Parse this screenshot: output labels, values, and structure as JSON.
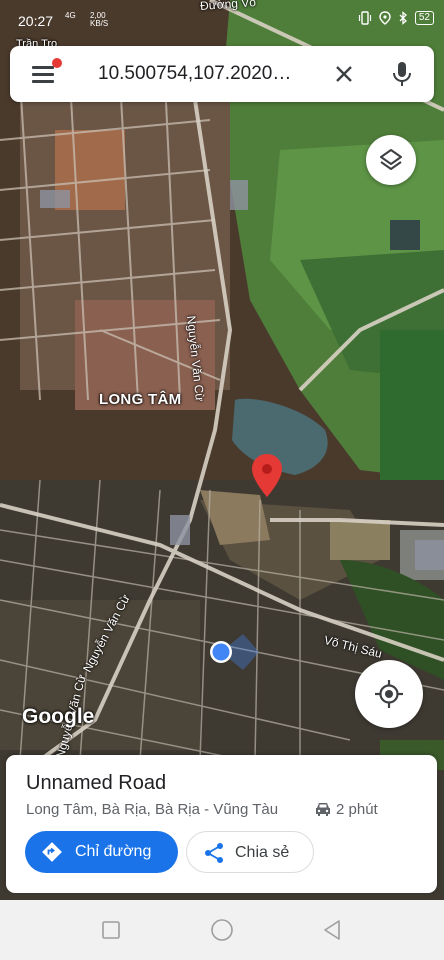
{
  "status_bar": {
    "time": "20:27",
    "network_speed": "2,00",
    "network_unit": "KB/S",
    "battery": "52",
    "network_type": "4G"
  },
  "search": {
    "query": "10.500754,107.2020…"
  },
  "map": {
    "area_label": "LONG TÂM",
    "street_labels": [
      "Nguyễn Văn Cừ",
      "Nguyễn Văn Cừ",
      "Võ Thị Sáu",
      "Nguyễn Văn Cừ"
    ],
    "top_street_label": "Đường Võ",
    "top_left_label": "Trần Trọ",
    "logo": "Google"
  },
  "place": {
    "title": "Unnamed Road",
    "address": "Long Tâm, Bà Rịa, Bà Rịa - Vũng Tàu",
    "drive_time": "2 phút",
    "directions_label": "Chỉ đường",
    "share_label": "Chia sẻ"
  },
  "colors": {
    "accent": "#1a73e8",
    "pin": "#e53935",
    "notification": "#e53935"
  }
}
